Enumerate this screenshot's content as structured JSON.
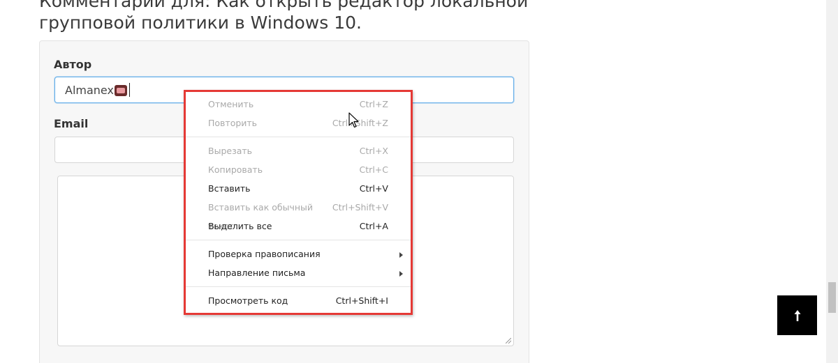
{
  "heading": {
    "line1": "Комментарий для: Как открыть редактор локальной",
    "line2": "групповой политики в Windows 10."
  },
  "form": {
    "author_label": "Автор",
    "author_value": "Almanex",
    "email_label": "Email",
    "email_value": ""
  },
  "context_menu": {
    "groups": [
      [
        {
          "label": "Отменить",
          "shortcut": "Ctrl+Z",
          "enabled": false
        },
        {
          "label": "Повторить",
          "shortcut": "Ctrl+Shift+Z",
          "enabled": false
        }
      ],
      [
        {
          "label": "Вырезать",
          "shortcut": "Ctrl+X",
          "enabled": false
        },
        {
          "label": "Копировать",
          "shortcut": "Ctrl+C",
          "enabled": false
        },
        {
          "label": "Вставить",
          "shortcut": "Ctrl+V",
          "enabled": true
        },
        {
          "label": "Вставить как обычный текст",
          "shortcut": "Ctrl+Shift+V",
          "enabled": false
        },
        {
          "label": "Выделить все",
          "shortcut": "Ctrl+A",
          "enabled": true
        }
      ],
      [
        {
          "label": "Проверка правописания",
          "submenu": true,
          "enabled": true
        },
        {
          "label": "Направление письма",
          "submenu": true,
          "enabled": true
        }
      ],
      [
        {
          "label": "Просмотреть код",
          "shortcut": "Ctrl+Shift+I",
          "enabled": true
        }
      ]
    ],
    "highlight_color": "#e53935"
  },
  "back_to_top": {
    "icon": "arrow-up-icon",
    "color": "#000000"
  }
}
